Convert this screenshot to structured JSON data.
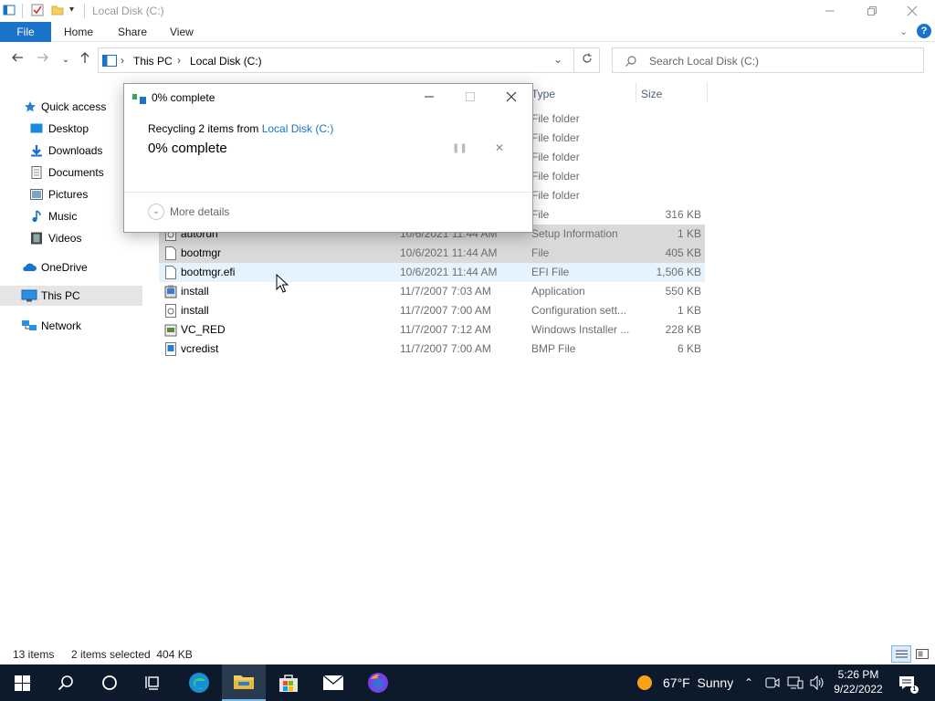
{
  "window": {
    "title": "Local Disk (C:)"
  },
  "ribbon": {
    "tabs": [
      "File",
      "Home",
      "Share",
      "View"
    ]
  },
  "address": {
    "crumbs": [
      "This PC",
      "Local Disk (C:)"
    ],
    "search_placeholder": "Search Local Disk (C:)"
  },
  "nav": {
    "quick_access": "Quick access",
    "items": [
      "Desktop",
      "Downloads",
      "Documents",
      "Pictures",
      "Music",
      "Videos"
    ],
    "onedrive": "OneDrive",
    "thispc": "This PC",
    "network": "Network"
  },
  "columns": {
    "type": "Type",
    "size": "Size"
  },
  "files": [
    {
      "name": "",
      "date": "",
      "type": "File folder",
      "size": ""
    },
    {
      "name": "",
      "date": "",
      "type": "File folder",
      "size": ""
    },
    {
      "name": "",
      "date": "",
      "type": "File folder",
      "size": ""
    },
    {
      "name": "",
      "date": "",
      "type": "File folder",
      "size": ""
    },
    {
      "name": "",
      "date": "",
      "type": "File folder",
      "size": ""
    },
    {
      "name": "",
      "date": "",
      "type": "File",
      "size": "316 KB"
    },
    {
      "name": "autorun",
      "date": "10/6/2021 11:44 AM",
      "type": "Setup Information",
      "size": "1 KB"
    },
    {
      "name": "bootmgr",
      "date": "10/6/2021 11:44 AM",
      "type": "File",
      "size": "405 KB"
    },
    {
      "name": "bootmgr.efi",
      "date": "10/6/2021 11:44 AM",
      "type": "EFI File",
      "size": "1,506 KB"
    },
    {
      "name": "install",
      "date": "11/7/2007 7:03 AM",
      "type": "Application",
      "size": "550 KB"
    },
    {
      "name": "install",
      "date": "11/7/2007 7:00 AM",
      "type": "Configuration sett...",
      "size": "1 KB"
    },
    {
      "name": "VC_RED",
      "date": "11/7/2007 7:12 AM",
      "type": "Windows Installer ...",
      "size": "228 KB"
    },
    {
      "name": "vcredist",
      "date": "11/7/2007 7:00 AM",
      "type": "BMP File",
      "size": "6 KB"
    }
  ],
  "dialog": {
    "title": "0% complete",
    "msg_prefix": "Recycling 2 items from ",
    "msg_link": "Local Disk (C:)",
    "percent": "0% complete",
    "more_details": "More details"
  },
  "status": {
    "count": "13 items",
    "selected": "2 items selected  404 KB"
  },
  "taskbar": {
    "weather": "67°F  Sunny",
    "time": "5:26 PM",
    "date": "9/22/2022"
  },
  "colors": {
    "accent": "#1a73c8",
    "taskbar": "#0c1a2c",
    "selection": "#cce8ff"
  }
}
